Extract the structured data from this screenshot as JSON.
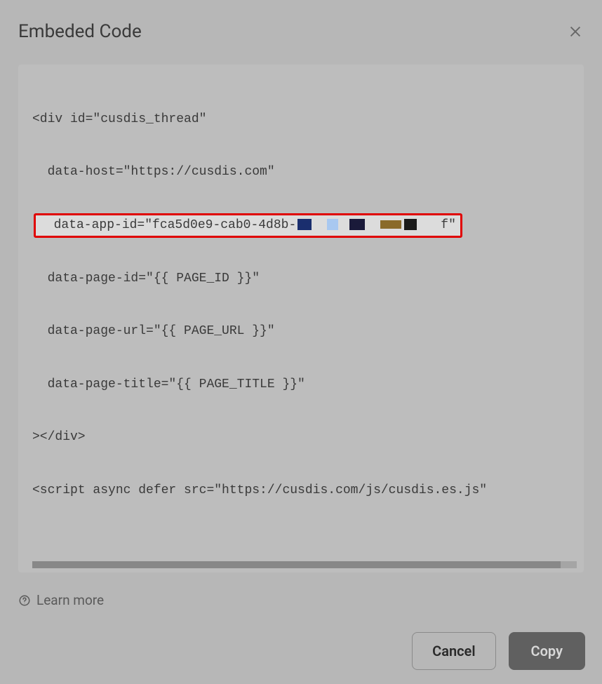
{
  "modal": {
    "title": "Embeded Code",
    "code": {
      "line1": "<div id=\"cusdis_thread\"",
      "line2": "  data-host=\"https://cusdis.com\"",
      "line3_prefix": "  data-app-id=\"fca5d0e9-cab0-4d8b-",
      "line3_suffix": "f\"",
      "line4": "  data-page-id=\"{{ PAGE_ID }}\"",
      "line5": "  data-page-url=\"{{ PAGE_URL }}\"",
      "line6": "  data-page-title=\"{{ PAGE_TITLE }}\"",
      "line7": "></div>",
      "line8": "<script async defer src=\"https://cusdis.com/js/cusdis.es.js\""
    },
    "learn_more": "Learn more",
    "buttons": {
      "cancel": "Cancel",
      "copy": "Copy"
    }
  }
}
